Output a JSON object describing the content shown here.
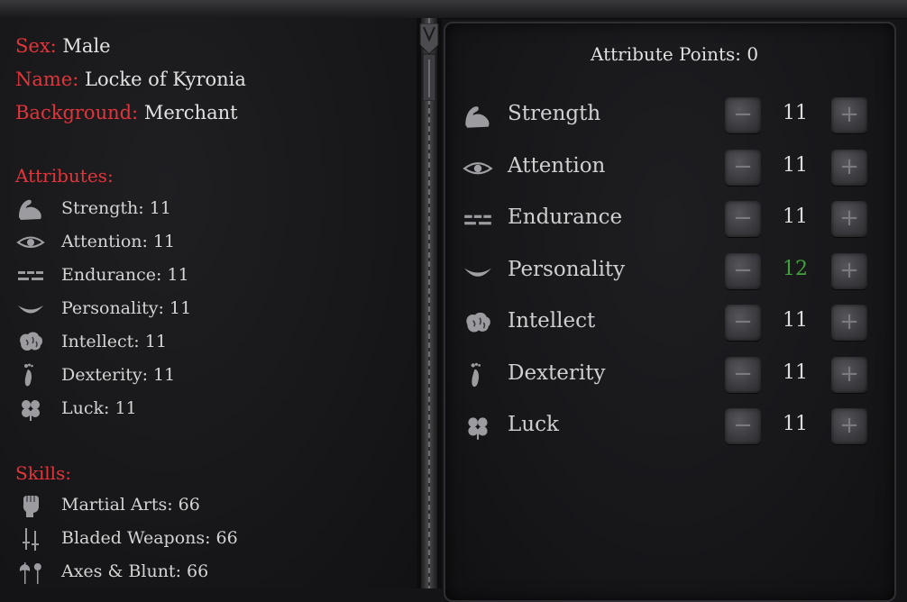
{
  "character": {
    "sex_label": "Sex:",
    "sex": "Male",
    "name_label": "Name:",
    "name": "Locke of Kyronia",
    "background_label": "Background:",
    "background": "Merchant"
  },
  "attributes_header": "Attributes:",
  "attributes_summary": [
    {
      "icon": "flexed-arm-icon",
      "text": "Strength: 11"
    },
    {
      "icon": "eye-icon",
      "text": "Attention: 11"
    },
    {
      "icon": "bricks-icon",
      "text": "Endurance: 11"
    },
    {
      "icon": "smile-icon",
      "text": "Personality: 11"
    },
    {
      "icon": "brain-icon",
      "text": "Intellect: 11"
    },
    {
      "icon": "footprint-icon",
      "text": "Dexterity: 11"
    },
    {
      "icon": "clover-icon",
      "text": "Luck: 11"
    }
  ],
  "skills_header": "Skills:",
  "skills": [
    {
      "icon": "fist-icon",
      "text": "Martial Arts: 66"
    },
    {
      "icon": "crossed-blades-icon",
      "text": "Bladed Weapons: 66"
    },
    {
      "icon": "axe-mace-icon",
      "text": "Axes & Blunt: 66"
    }
  ],
  "allocation": {
    "points_label": "Attribute Points: 0",
    "minus_symbol": "−",
    "plus_symbol": "+",
    "rows": [
      {
        "icon": "flexed-arm-icon",
        "name": "Strength",
        "value": "11",
        "modified": false
      },
      {
        "icon": "eye-icon",
        "name": "Attention",
        "value": "11",
        "modified": false
      },
      {
        "icon": "bricks-icon",
        "name": "Endurance",
        "value": "11",
        "modified": false
      },
      {
        "icon": "smile-icon",
        "name": "Personality",
        "value": "12",
        "modified": true
      },
      {
        "icon": "brain-icon",
        "name": "Intellect",
        "value": "11",
        "modified": false
      },
      {
        "icon": "footprint-icon",
        "name": "Dexterity",
        "value": "11",
        "modified": false
      },
      {
        "icon": "clover-icon",
        "name": "Luck",
        "value": "11",
        "modified": false
      }
    ]
  },
  "colors": {
    "label_red": "#e0353a",
    "modified_green": "#3fa23a"
  }
}
